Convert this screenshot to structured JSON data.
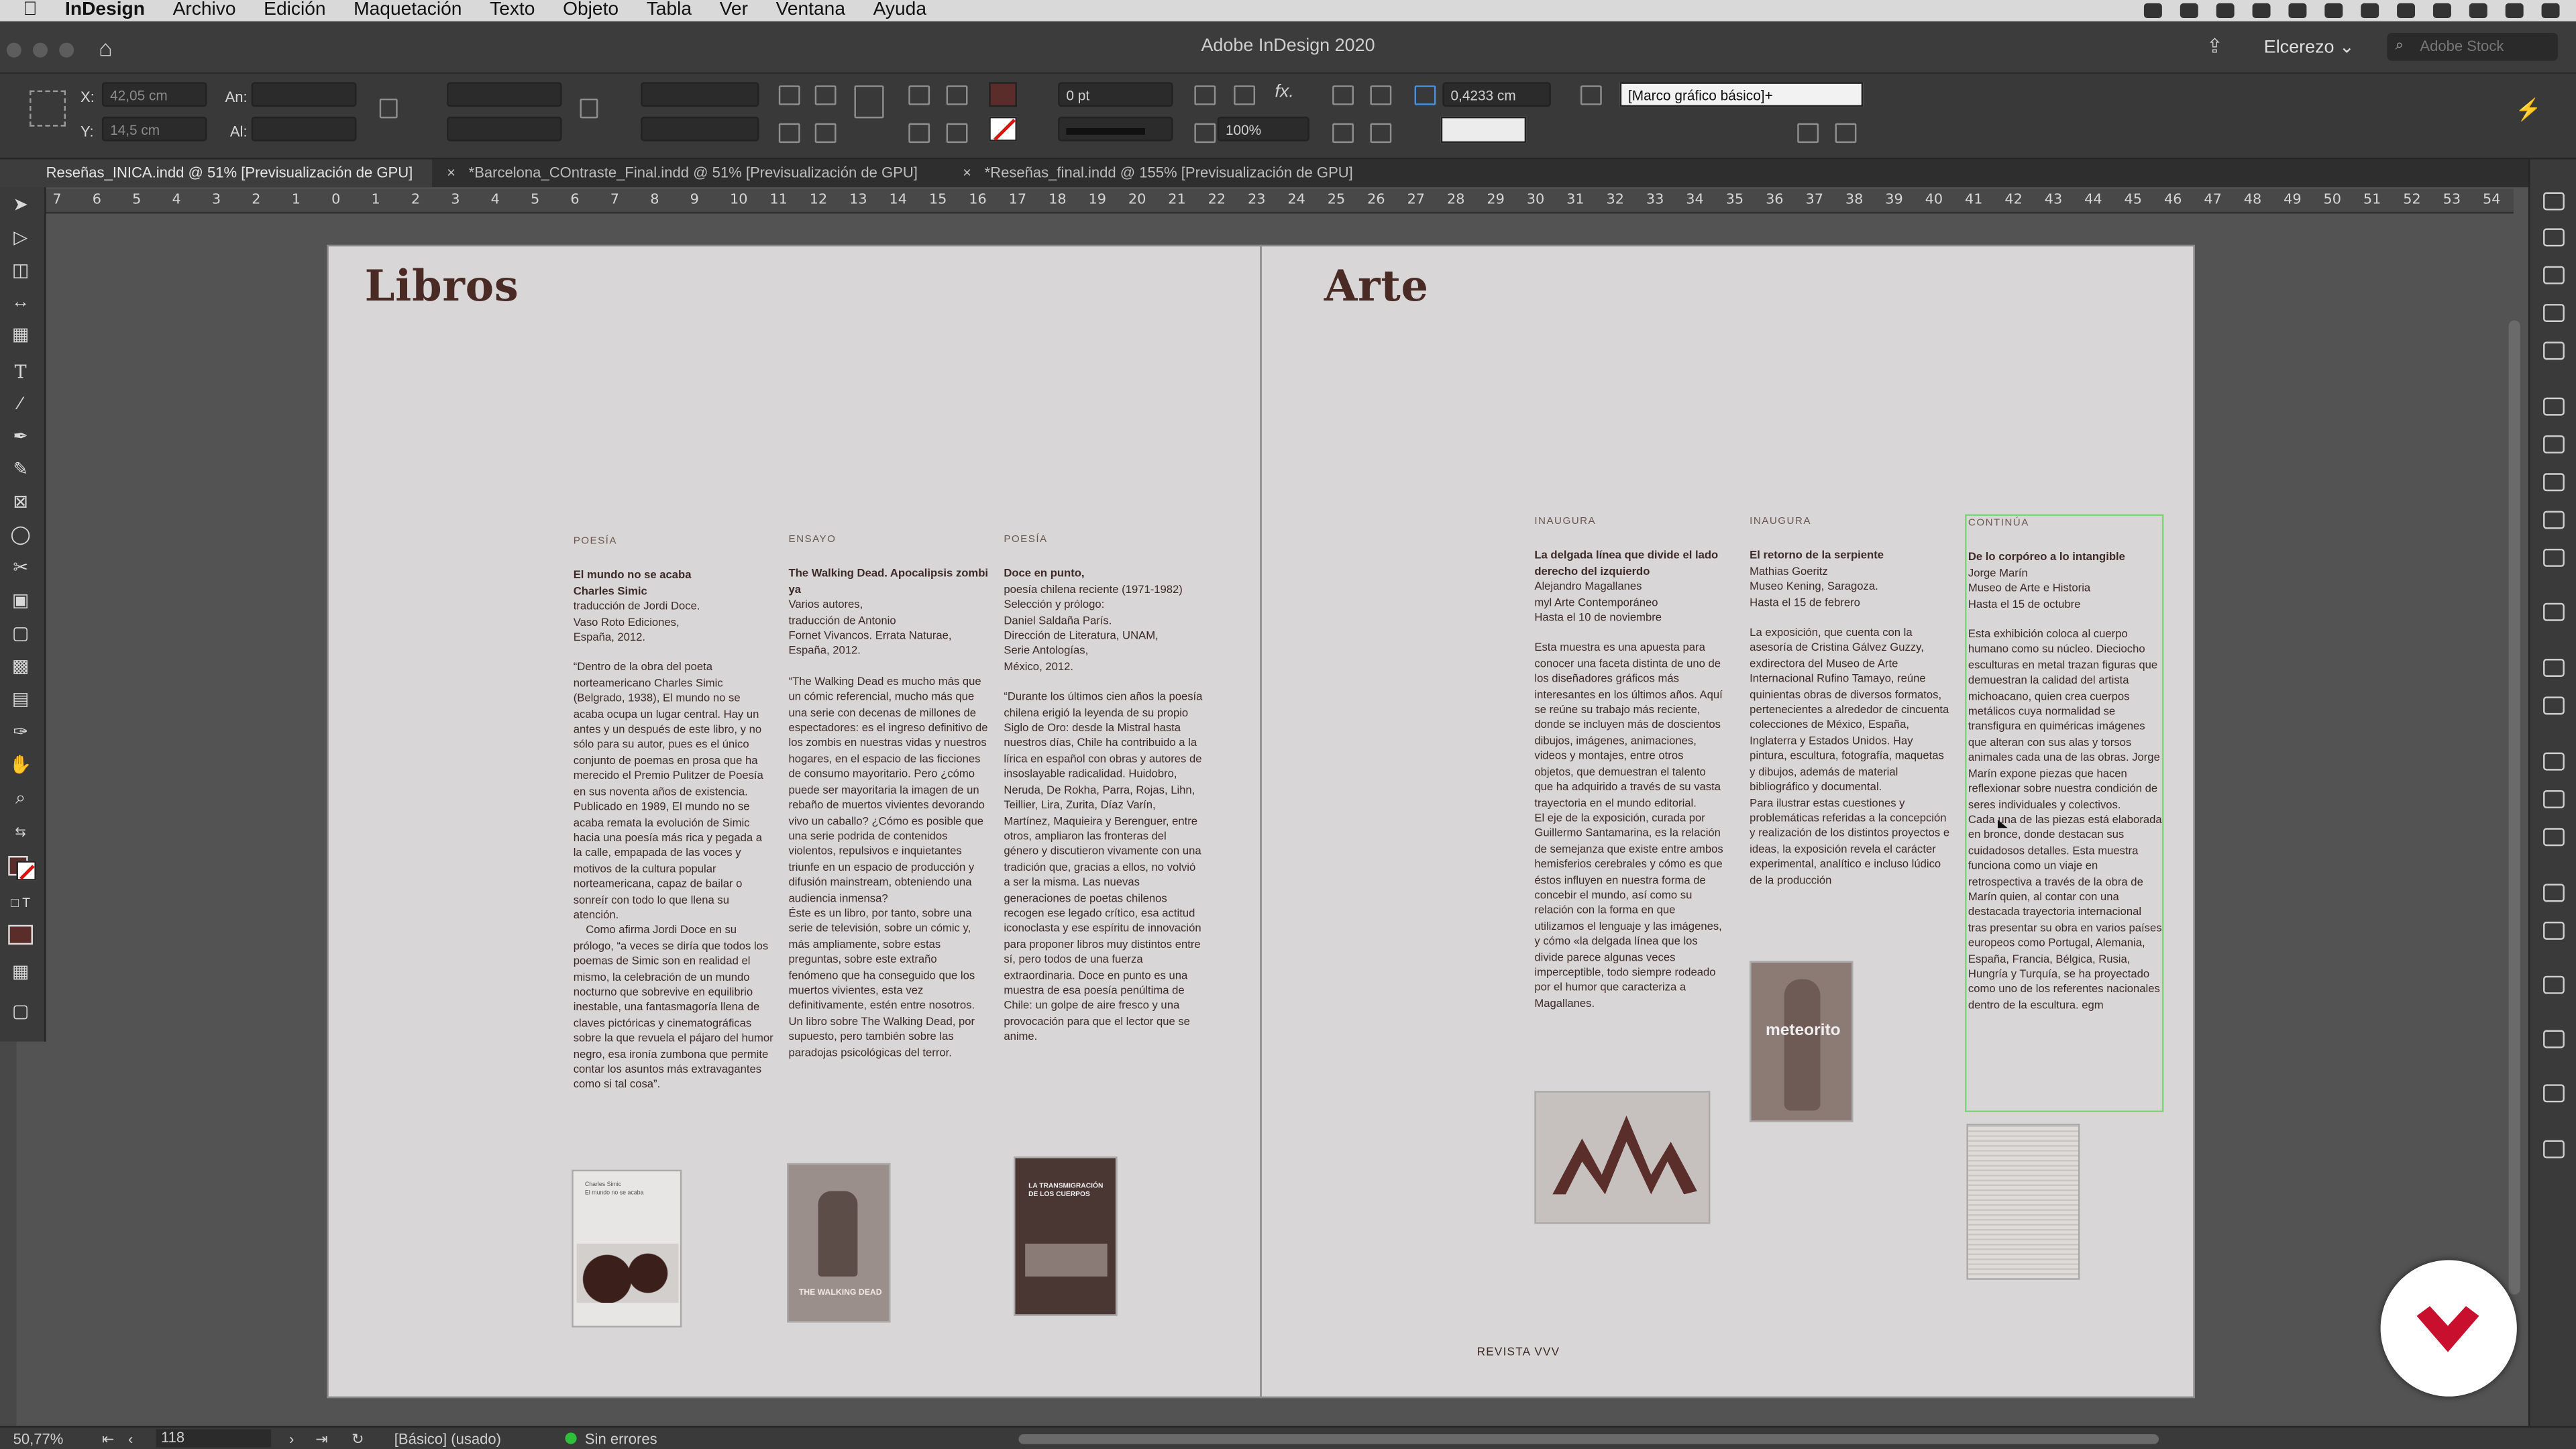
{
  "menubar": {
    "app_name": "InDesign",
    "items": [
      "Archivo",
      "Edición",
      "Maquetación",
      "Texto",
      "Objeto",
      "Tabla",
      "Ver",
      "Ventana",
      "Ayuda"
    ]
  },
  "window": {
    "title": "Adobe InDesign 2020",
    "workspace": "Elcerezo",
    "search_placeholder": "Adobe Stock"
  },
  "control": {
    "x_label": "X:",
    "x_value": "42,05 cm",
    "y_label": "Y:",
    "y_value": "14,5 cm",
    "an_label": "An:",
    "al_label": "Al:",
    "stroke_weight": "0 pt",
    "scale": "100%",
    "offset": "0,4233 cm",
    "style": "[Marco gráfico básico]+"
  },
  "tabs": [
    {
      "label": "Reseñas_INICA.indd @ 51% [Previsualización de GPU]",
      "active": true
    },
    {
      "label": "*Barcelona_COntraste_Final.indd @ 51% [Previsualización de GPU]",
      "active": false
    },
    {
      "label": "*Reseñas_final.indd @ 155% [Previsualización de GPU]",
      "active": false
    }
  ],
  "ruler": [
    "7",
    "6",
    "5",
    "4",
    "3",
    "2",
    "1",
    "0",
    "1",
    "2",
    "3",
    "4",
    "5",
    "6",
    "7",
    "8",
    "9",
    "10",
    "11",
    "12",
    "13",
    "14",
    "15",
    "16",
    "17",
    "18",
    "19",
    "20",
    "21",
    "22",
    "23",
    "24",
    "25",
    "26",
    "27",
    "28",
    "29",
    "30",
    "31",
    "32",
    "33",
    "34",
    "35",
    "36",
    "37",
    "38",
    "39",
    "40",
    "41",
    "42",
    "43",
    "44",
    "45",
    "46",
    "47",
    "48",
    "49",
    "50",
    "51",
    "52",
    "53",
    "54"
  ],
  "left_page": {
    "title": "Libros",
    "columns": [
      {
        "kicker": "POESÍA",
        "head": "El mundo no se acaba\nCharles Simic",
        "meta": "traducción de Jordi Doce.\nVaso Roto Ediciones,\nEspaña, 2012.",
        "body": "“Dentro de la obra del poeta norteamericano Charles Simic (Belgrado, 1938), El mundo no se acaba ocupa un lugar central. Hay un antes y un después de este libro, y no sólo para su autor, pues es el único conjunto de poemas en prosa que ha merecido el Premio Pulitzer de Poesía en sus noventa años de existencia. Publicado en 1989, El mundo no se acaba remata la evolución de Simic hacia una poesía más rica y pegada a la calle, empapada de las voces y motivos de la cultura popular norteamericana, capaz de bailar o sonreír con todo lo que llena su atención.\n    Como afirma Jordi Doce en su prólogo, “a veces se diría que todos los poemas de Simic son en realidad el mismo, la celebración de un mundo nocturno que sobrevive en equilibrio inestable, una fantasmagoría llena de claves pictóricas y cinematográficas sobre la que revuela el pájaro del humor negro, esa ironía zumbona que permite contar los asuntos más extravagantes como si tal cosa”."
      },
      {
        "kicker": "ENSAYO",
        "head": "The Walking Dead. Apocalipsis zombi ya",
        "meta": "Varios autores,\ntraducción de Antonio\nFornet Vivancos. Errata Naturae,\nEspaña, 2012.",
        "body": "“The Walking Dead es mucho más que un cómic referencial, mucho más que una serie con decenas de millones de espectadores: es el ingreso definitivo de los zombis en nuestras vidas y nuestros hogares, en el espacio de las ficciones de consumo mayoritario. Pero ¿cómo puede ser mayoritaria la imagen de un rebaño de muertos vivientes devorando vivo un caballo? ¿Cómo es posible que una serie podrida de contenidos violentos, repulsivos e inquietantes triunfe en un espacio de producción y difusión mainstream, obteniendo una audiencia inmensa?\nÉste es un libro, por tanto, sobre una serie de televisión, sobre un cómic y, más ampliamente, sobre estas preguntas, sobre este extraño fenómeno que ha conseguido que los muertos vivientes, esta vez definitivamente, estén entre nosotros. Un libro sobre The Walking Dead, por supuesto, pero también sobre las paradojas psicológicas del terror."
      },
      {
        "kicker": "POESÍA",
        "head": "Doce en punto,",
        "meta": "poesía chilena reciente (1971-1982)\nSelección y prólogo:\nDaniel Saldaña París.\nDirección de Literatura, UNAM,\nSerie Antologías,\nMéxico, 2012.",
        "body": "“Durante los últimos cien años la poesía chilena erigió la leyenda de su propio Siglo de Oro: desde la Mistral hasta nuestros días, Chile ha contribuido a la lírica en español con obras y autores de insoslayable radicalidad. Huidobro, Neruda, De Rokha, Parra, Rojas, Lihn, Teillier, Lira, Zurita, Díaz Varín, Martínez, Maquieira y Berenguer, entre otros, ampliaron las fronteras del género y discutieron vivamente con una tradición que, gracias a ellos, no volvió a ser la misma. Las nuevas generaciones de poetas chilenos recogen ese legado crítico, esa actitud iconoclasta y ese espíritu de innovación para proponer libros muy distintos entre sí, pero todos de una fuerza extraordinaria. Doce en punto es una muestra de esa poesía penúltima de Chile: un golpe de aire fresco y una provocación para que el lector que se anime."
      }
    ],
    "covers": [
      {
        "title": "Charles Simic\nEl mundo no se acaba"
      },
      {
        "title": "THE WALKING DEAD"
      },
      {
        "title": "LA TRANSMIGRACIÓN\nDE LOS CUERPOS"
      }
    ]
  },
  "right_page": {
    "title": "Arte",
    "footer": "REVISTA VVV",
    "columns": [
      {
        "kicker": "INAUGURA",
        "head": "La delgada línea que divide el lado derecho del izquierdo",
        "meta": "Alejandro Magallanes\nmyl Arte Contemporáneo\nHasta el 10 de noviembre",
        "body": "Esta muestra es una apuesta para conocer una faceta distinta de uno de los diseñadores gráficos más interesantes en los últimos años. Aquí se reúne su trabajo más reciente, donde se incluyen más de doscientos dibujos, imágenes, animaciones, videos y montajes, entre otros objetos, que demuestran el talento que ha adquirido a través de su vasta trayectoria en el mundo editorial.\nEl eje de la exposición, curada por Guillermo Santamarina, es la relación de semejanza que existe entre ambos hemisferios cerebrales y cómo es que éstos influyen en nuestra forma de concebir el mundo, así como su relación con la forma en que utilizamos el lenguaje y las imágenes, y cómo «la delgada línea que los divide parece algunas veces imperceptible, todo siempre rodeado por el humor que caracteriza a Magallanes."
      },
      {
        "kicker": "INAUGURA",
        "head": "El retorno de la serpiente",
        "meta": "Mathias Goeritz\nMuseo Kening, Saragoza.\nHasta el 15 de febrero",
        "body": "La exposición, que cuenta con la asesoría de Cristina Gálvez Guzzy, exdirectora del Museo de Arte Internacional Rufino Tamayo, reúne quinientas obras de diversos formatos, pertenecientes a alrededor de cincuenta colecciones de México, España, Inglaterra y Estados Unidos. Hay pintura, escultura, fotografía, maquetas y dibujos, además de material bibliográfico y documental.\nPara ilustrar estas cuestiones y problemáticas referidas a la concepción y realización de los distintos proyectos e ideas, la exposición revela el carácter experimental, analítico e incluso lúdico de la producción"
      },
      {
        "kicker": "CONTINÚA",
        "head": "De lo corpóreo a lo intangible",
        "meta": "Jorge Marín\nMuseo de Arte e Historia\nHasta el 15 de octubre",
        "body": "Esta exhibición coloca al cuerpo humano como su núcleo. Dieciocho esculturas en metal trazan figuras que demuestran la calidad del artista michoacano, quien crea cuerpos metálicos cuya normalidad se transfigura en quiméricas imágenes que alteran con sus alas y torsos animales cada una de las obras. Jorge Marín expone piezas que hacen reflexionar sobre nuestra condición de seres individuales y colectivos.\nCada una de las piezas está elaborada en bronce, donde destacan sus cuidadosos detalles. Esta muestra funciona como un viaje en retrospectiva a través de la obra de Marín quien, al contar con una destacada trayectoria internacional tras presentar su obra en varios países europeos como Portugal, Alemania, España, Francia, Bélgica, Rusia, Hungría y Turquía, se ha proyectado como uno de los referentes nacionales dentro de la escultura. egm"
      }
    ],
    "images": [
      {
        "label": ""
      },
      {
        "label": "meteorito"
      },
      {
        "label": ""
      }
    ]
  },
  "status": {
    "zoom": "50,77%",
    "page": "118",
    "style": "[Básico] (usado)",
    "errors": "Sin errores"
  },
  "colors": {
    "title": "#4a2a24",
    "body": "#3d2a28",
    "page": "#d8d6d6",
    "pasteboard": "#535353",
    "brand": "#c8102e"
  }
}
